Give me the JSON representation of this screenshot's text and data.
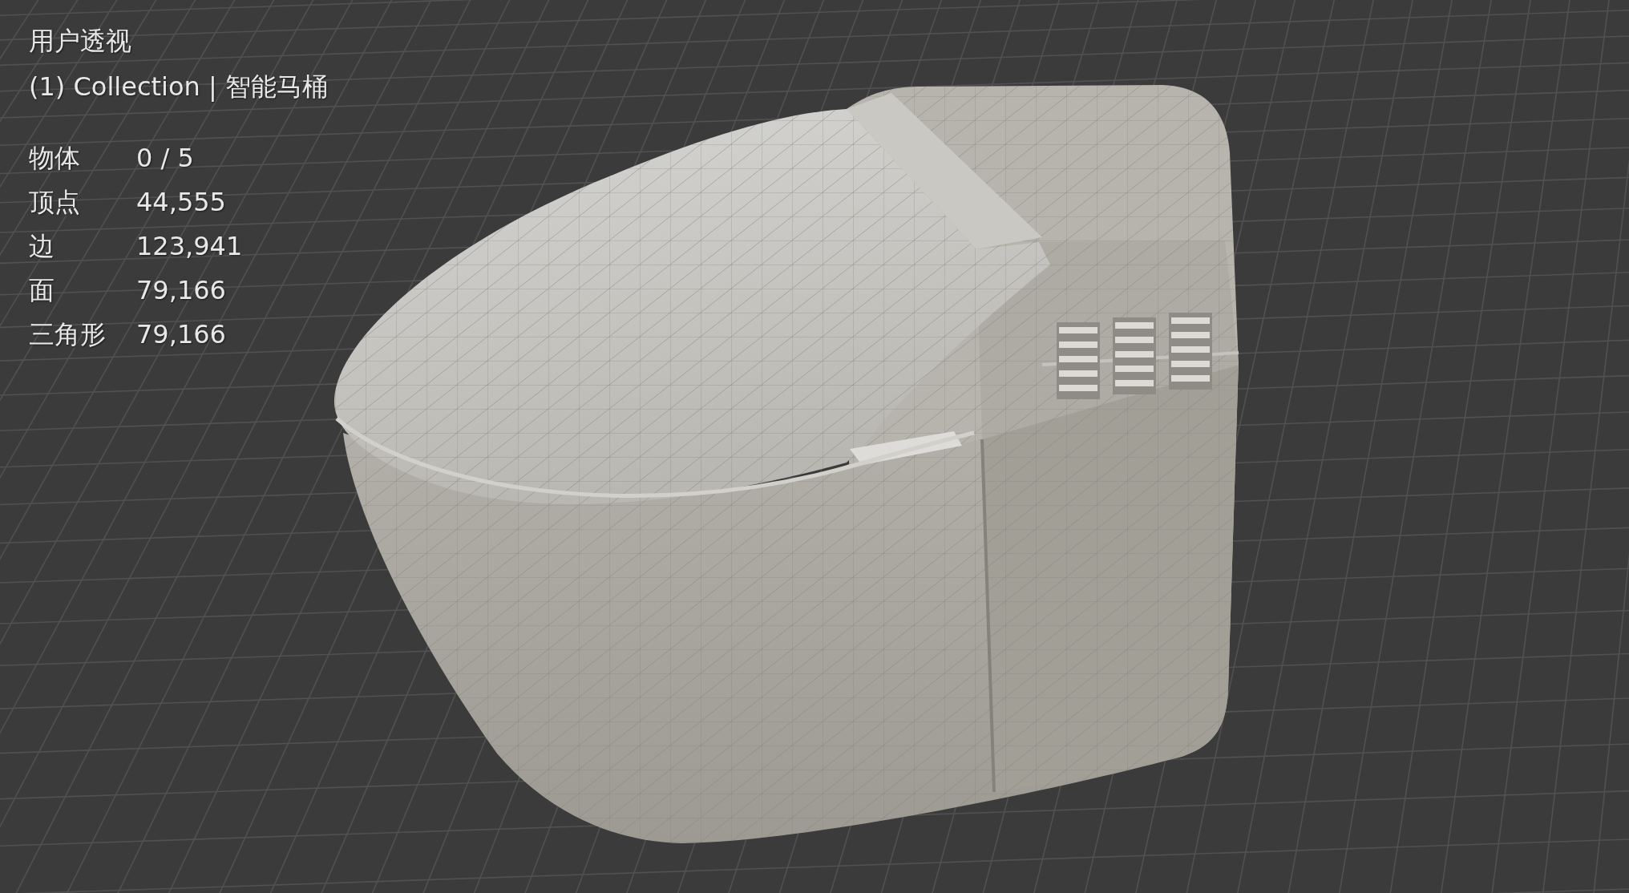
{
  "viewport": {
    "view_name": "用户透视",
    "collection": "(1) Collection | 智能马桶",
    "stats": [
      {
        "label": "物体",
        "value": "0 / 5"
      },
      {
        "label": "顶点",
        "value": "44,555"
      },
      {
        "label": "边",
        "value": "123,941"
      },
      {
        "label": "面",
        "value": "79,166"
      },
      {
        "label": "三角形",
        "value": "79,166"
      }
    ]
  }
}
